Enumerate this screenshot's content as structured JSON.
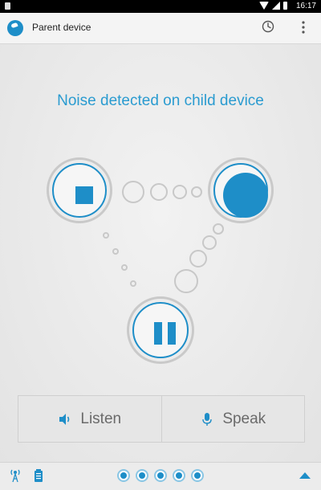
{
  "status_bar": {
    "time": "16:17"
  },
  "app": {
    "title": "Parent device"
  },
  "main": {
    "headline": "Noise detected on child device"
  },
  "controls": {
    "listen_label": "Listen",
    "speak_label": "Speak"
  },
  "icons": {
    "accent": "#1e8ec8",
    "history": "history-icon",
    "menu": "overflow-menu-icon",
    "speaker": "speaker-icon",
    "mic": "mic-icon"
  },
  "bottom_bar": {
    "page_count": 5
  }
}
